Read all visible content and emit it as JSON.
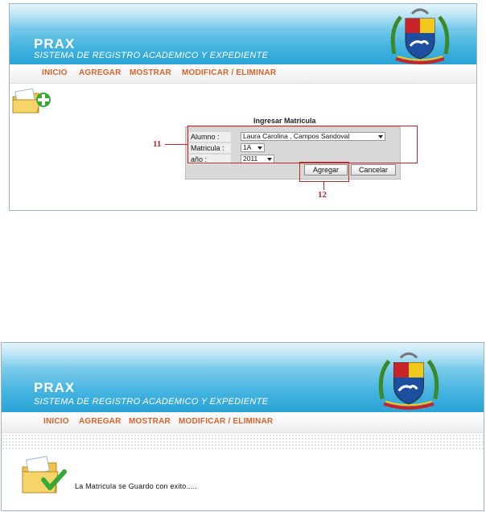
{
  "app": {
    "title": "PRAX",
    "subtitle": "SISTEMA DE REGISTRO ACADEMICO Y EXPEDIENTE"
  },
  "nav": {
    "items": [
      "INICIO",
      "AGREGAR",
      "MOSTRAR",
      "MODIFICAR / ELIMINAR"
    ]
  },
  "form": {
    "title": "Ingresar Matricula",
    "alumno_label": "Alumno :",
    "alumno_value": "Laura Carolina , Campos Sandoval",
    "matricula_label": "Matricula :",
    "matricula_value": "1A",
    "anio_label": "año :",
    "anio_value": "2011",
    "agregar_label": "Agregar",
    "cancelar_label": "Cancelar"
  },
  "callouts": {
    "fields_number": "11",
    "button_number": "12"
  },
  "result": {
    "message": "La Matricula se Guardo con exito....."
  },
  "colors": {
    "nav_text": "#d9622b",
    "callout": "#c0282d",
    "banner": "#2aa3d6"
  },
  "icons": [
    "folder-add-icon",
    "folder-check-icon",
    "coat-of-arms-icon"
  ]
}
